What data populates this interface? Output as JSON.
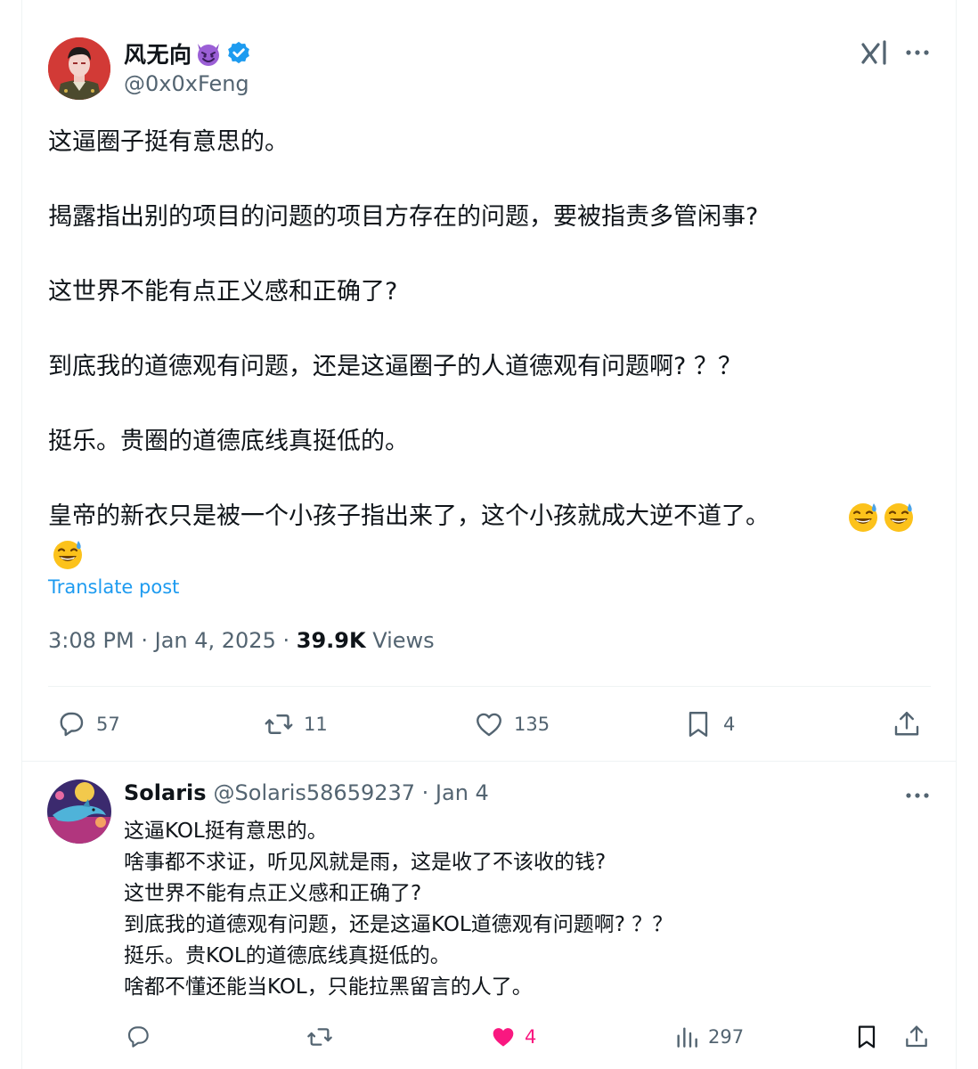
{
  "main_tweet": {
    "display_name": "风无向",
    "handle": "@0x0xFeng",
    "lines": [
      "这逼圈子挺有意思的。",
      "揭露指出别的项目的问题的项目方存在的问题，要被指责多管闲事?",
      "这世界不能有点正义感和正确了?",
      "到底我的道德观有问题，还是这逼圈子的人道德观有问题啊? ？？",
      "挺乐。贵圈的道德底线真挺低的。",
      "皇帝的新衣只是被一个小孩子指出来了，这个小孩就成大逆不道了。"
    ],
    "translate_label": "Translate post",
    "time": "3:08 PM",
    "date": "Jan 4, 2025",
    "views_count": "39.9K",
    "views_label": "Views",
    "actions": {
      "replies": "57",
      "reposts": "11",
      "likes": "135",
      "bookmarks": "4"
    }
  },
  "reply": {
    "display_name": "Solaris",
    "handle": "@Solaris58659237 · Jan 4",
    "lines": [
      "这逼KOL挺有意思的。",
      "啥事都不求证，听见风就是雨，这是收了不该收的钱?",
      "这世界不能有点正义感和正确了?",
      "到底我的道德观有问题，还是这逼KOL道德观有问题啊? ？？",
      "挺乐。贵KOL的道德底线真挺低的。",
      "啥都不懂还能当KOL，只能拉黑留言的人了。"
    ],
    "actions": {
      "likes": "4",
      "views": "297"
    }
  },
  "colors": {
    "accent": "#1d9bf0",
    "text": "#0f1419",
    "secondary": "#536471",
    "like_active": "#f91880",
    "divider": "#eff3f4"
  }
}
